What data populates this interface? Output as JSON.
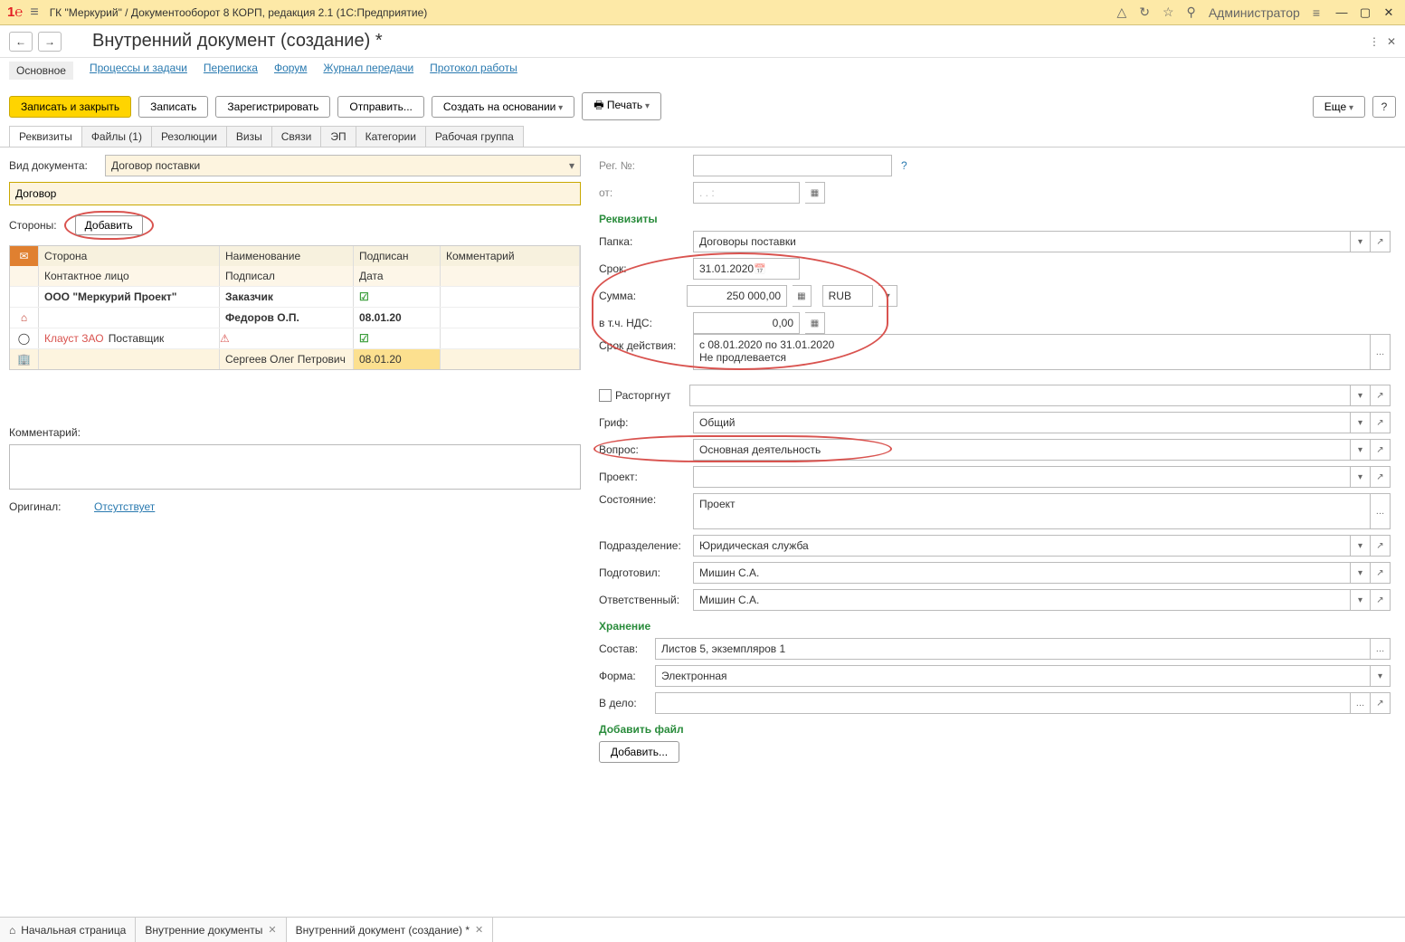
{
  "titlebar": {
    "app_title": "ГК \"Меркурий\" / Документооборот 8 КОРП, редакция 2.1  (1С:Предприятие)",
    "user": "Администратор"
  },
  "page_title": "Внутренний документ (создание) *",
  "nav_links": [
    "Основное",
    "Процессы и задачи",
    "Переписка",
    "Форум",
    "Журнал передачи",
    "Протокол работы"
  ],
  "actions": {
    "save_close": "Записать и закрыть",
    "save": "Записать",
    "register": "Зарегистрировать",
    "send": "Отправить...",
    "create_based": "Создать на основании",
    "print": "Печать",
    "more": "Еще"
  },
  "tabs": [
    "Реквизиты",
    "Файлы (1)",
    "Резолюции",
    "Визы",
    "Связи",
    "ЭП",
    "Категории",
    "Рабочая группа"
  ],
  "left": {
    "doc_type_label": "Вид документа:",
    "doc_type": "Договор поставки",
    "doc_name": "Договор",
    "sides_label": "Стороны:",
    "add_btn": "Добавить",
    "headers": {
      "side": "Сторона",
      "name": "Наименование",
      "signed": "Подписан",
      "comment": "Комментарий",
      "contact": "Контактное лицо",
      "signer": "Подписал",
      "date": "Дата"
    },
    "rows": [
      {
        "side": "ООО \"Меркурий Проект\"",
        "role": "Заказчик",
        "signed": true,
        "contact": "",
        "signer": "Федоров О.П.",
        "date": "08.01.20"
      },
      {
        "side": "Клауст ЗАО",
        "role": "Поставщик",
        "signed": true,
        "warn": true,
        "contact": "",
        "signer": "Сергеев Олег Петрович",
        "date": "08.01.20"
      }
    ],
    "comment_label": "Комментарий:",
    "original_label": "Оригинал:",
    "original_link": "Отсутствует"
  },
  "right": {
    "reg_no_label": "Рег. №:",
    "from_label": "от:",
    "from_placeholder": ".  .        :",
    "details_head": "Реквизиты",
    "folder_label": "Папка:",
    "folder": "Договоры поставки",
    "term_label": "Срок:",
    "term": "31.01.2020",
    "sum_label": "Сумма:",
    "sum": "250 000,00",
    "currency": "RUB",
    "vat_label": "в т.ч. НДС:",
    "vat": "0,00",
    "validity_label": "Срок действия:",
    "validity": "с 08.01.2020 по 31.01.2020\nНе продлевается",
    "terminated_label": "Расторгнут",
    "grif_label": "Гриф:",
    "grif": "Общий",
    "question_label": "Вопрос:",
    "question": "Основная деятельность",
    "project_label": "Проект:",
    "status_label": "Состояние:",
    "status": "Проект",
    "dept_label": "Подразделение:",
    "dept": "Юридическая служба",
    "prepared_label": "Подготовил:",
    "prepared": "Мишин С.А.",
    "responsible_label": "Ответственный:",
    "responsible": "Мишин С.А.",
    "storage_head": "Хранение",
    "content_label": "Состав:",
    "content": "Листов 5, экземпляров 1",
    "form_label": "Форма:",
    "form": "Электронная",
    "case_label": "В дело:",
    "add_file_head": "Добавить файл",
    "add_file_btn": "Добавить..."
  },
  "taskbar": {
    "home": "Начальная страница",
    "t1": "Внутренние документы",
    "t2": "Внутренний документ (создание) *"
  }
}
